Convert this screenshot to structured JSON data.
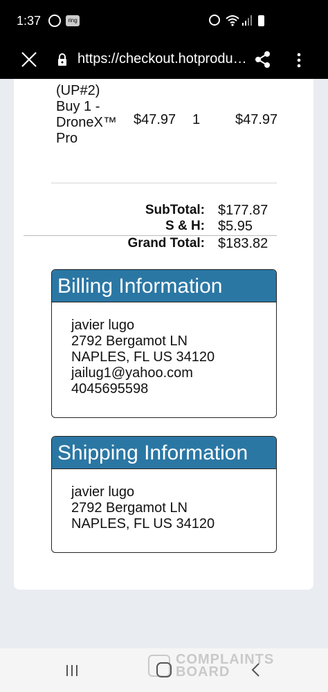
{
  "status_bar": {
    "time": "1:37",
    "ring_label": "ring"
  },
  "browser": {
    "url": "https://checkout.hotproducts..."
  },
  "order_item": {
    "name_lines": [
      "(UP#2)",
      "Buy 1 -",
      "DroneX™",
      "Pro"
    ],
    "price": "$47.97",
    "quantity": "1",
    "total": "$47.97"
  },
  "totals": {
    "subtotal_label": "SubTotal:",
    "subtotal_value": "$177.87",
    "sh_label": "S & H:",
    "sh_value": "$5.95",
    "grand_label": "Grand Total:",
    "grand_value": "$183.82"
  },
  "billing": {
    "title": "Billing Information",
    "lines": [
      "javier lugo",
      "2792 Bergamot LN",
      "NAPLES, FL US 34120",
      "jailug1@yahoo.com",
      "4045695598"
    ]
  },
  "shipping": {
    "title": "Shipping Information",
    "lines": [
      "javier lugo",
      "2792 Bergamot LN",
      "NAPLES, FL US 34120"
    ]
  },
  "watermark": {
    "line1": "COMPLAINTS",
    "line2": "BOARD"
  },
  "colors": {
    "header_blue": "#2b77a4",
    "background": "#e9edf2"
  }
}
